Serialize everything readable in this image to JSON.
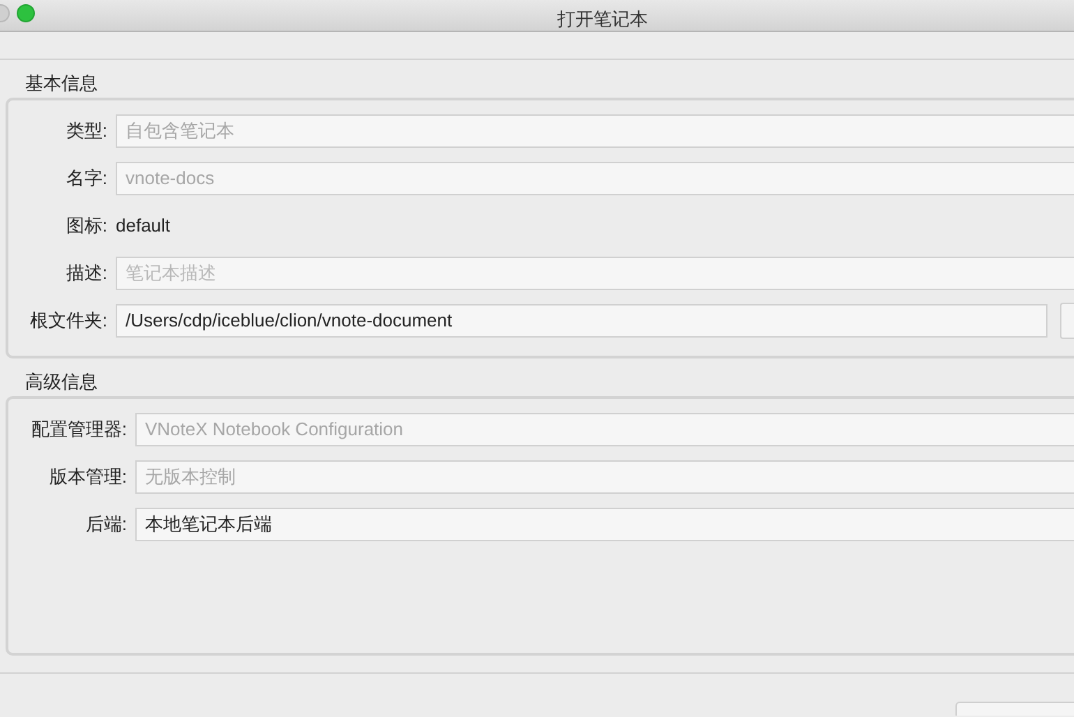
{
  "window": {
    "title": "打开笔记本"
  },
  "groups": [
    {
      "title": "基本信息",
      "rows": [
        {
          "kind": "field",
          "label": "类型:",
          "value": "自包含笔记本",
          "disabled": true
        },
        {
          "kind": "field",
          "label": "名字:",
          "value": "vnote-docs",
          "disabled": true
        },
        {
          "kind": "text",
          "label": "图标:",
          "value": "default"
        },
        {
          "kind": "field",
          "label": "描述:",
          "placeholder": "笔记本描述"
        },
        {
          "kind": "browse",
          "label": "根文件夹:",
          "value": "/Users/cdp/iceblue/clion/vnote-document",
          "disabled": false
        }
      ]
    },
    {
      "title": "高级信息",
      "rows": [
        {
          "kind": "field",
          "label": "配置管理器:",
          "value": "VNoteX Notebook Configuration",
          "disabled": true
        },
        {
          "kind": "field",
          "label": "版本管理:",
          "value": "无版本控制",
          "disabled": true
        },
        {
          "kind": "field",
          "label": "后端:",
          "value": "本地笔记本后端",
          "disabled": false
        }
      ]
    }
  ]
}
